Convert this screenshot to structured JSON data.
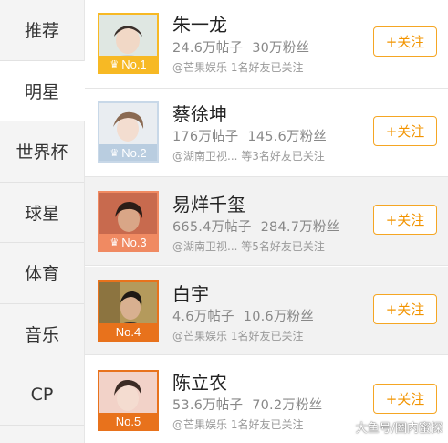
{
  "sidebar": {
    "items": [
      {
        "label": "推荐"
      },
      {
        "label": "明星"
      },
      {
        "label": "世界杯"
      },
      {
        "label": "球星"
      },
      {
        "label": "体育"
      },
      {
        "label": "音乐"
      },
      {
        "label": "CP"
      }
    ],
    "active_index": 1
  },
  "stars": [
    {
      "name": "朱一龙",
      "posts": "24.6万帖子",
      "fans": "30万粉丝",
      "friends": "@芒果娱乐 1名好友已关注",
      "rank": "No.1",
      "follow_label": "+关注",
      "badge_color": "#f7b924",
      "frame_color": "#f7b924"
    },
    {
      "name": "蔡徐坤",
      "posts": "176万帖子",
      "fans": "145.6万粉丝",
      "friends": "@湖南卫视... 等3名好友已关注",
      "rank": "No.2",
      "follow_label": "+关注",
      "badge_color": "#b9cde0",
      "frame_color": "#c8d8e8"
    },
    {
      "name": "易烊千玺",
      "posts": "665.4万帖子",
      "fans": "284.7万粉丝",
      "friends": "@湖南卫视... 等5名好友已关注",
      "rank": "No.3",
      "follow_label": "+关注",
      "badge_color": "#f08a62",
      "frame_color": "#f08a62"
    },
    {
      "name": "白宇",
      "posts": "4.6万帖子",
      "fans": "10.6万粉丝",
      "friends": "@芒果娱乐 1名好友已关注",
      "rank": "No.4",
      "follow_label": "+关注",
      "badge_color": "#e8721c",
      "frame_color": "#e8721c"
    },
    {
      "name": "陈立农",
      "posts": "53.6万帖子",
      "fans": "70.2万粉丝",
      "friends": "@芒果娱乐 1名好友已关注",
      "rank": "No.5",
      "follow_label": "+关注",
      "badge_color": "#e8721c",
      "frame_color": "#e8721c"
    }
  ],
  "watermark": "大鱼号/圈内蜜探",
  "colors": {
    "accent": "#f29400",
    "highlight_row": "#f2f2f2"
  }
}
